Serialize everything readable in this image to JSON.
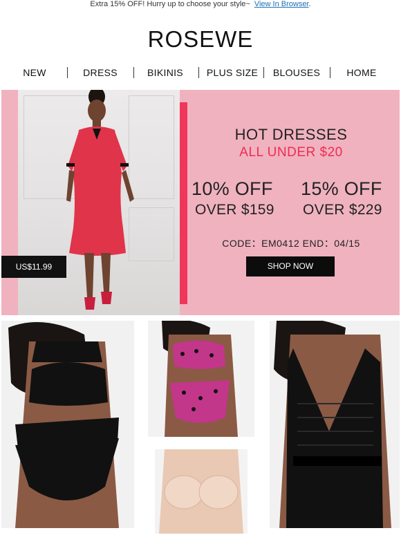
{
  "banner": {
    "promo_text": "Extra 15% OFF! Hurry up to choose your style~",
    "link_text": "View In Browser"
  },
  "brand": {
    "logo_text": "ROSEWE"
  },
  "nav": {
    "items": [
      {
        "label": "NEW"
      },
      {
        "label": "DRESS"
      },
      {
        "label": "BIKINIS"
      },
      {
        "label": "PLUS SIZE"
      },
      {
        "label": "BLOUSES"
      },
      {
        "label": "HOME"
      }
    ]
  },
  "hero": {
    "price_tag": "US$11.99",
    "title": "HOT DRESSES",
    "subtitle": "ALL UNDER $20",
    "offers": [
      {
        "discount": "10% OFF",
        "threshold": "OVER $159"
      },
      {
        "discount": "15% OFF",
        "threshold": "OVER $229"
      }
    ],
    "code_line": "CODE：EM0412  END：04/15",
    "shop_button": "SHOP NOW"
  },
  "colors": {
    "hero_bg": "#f0b2bf",
    "accent_red": "#ee2c53",
    "strip_red": "#f0365a",
    "button_bg": "#0c0c0c"
  }
}
